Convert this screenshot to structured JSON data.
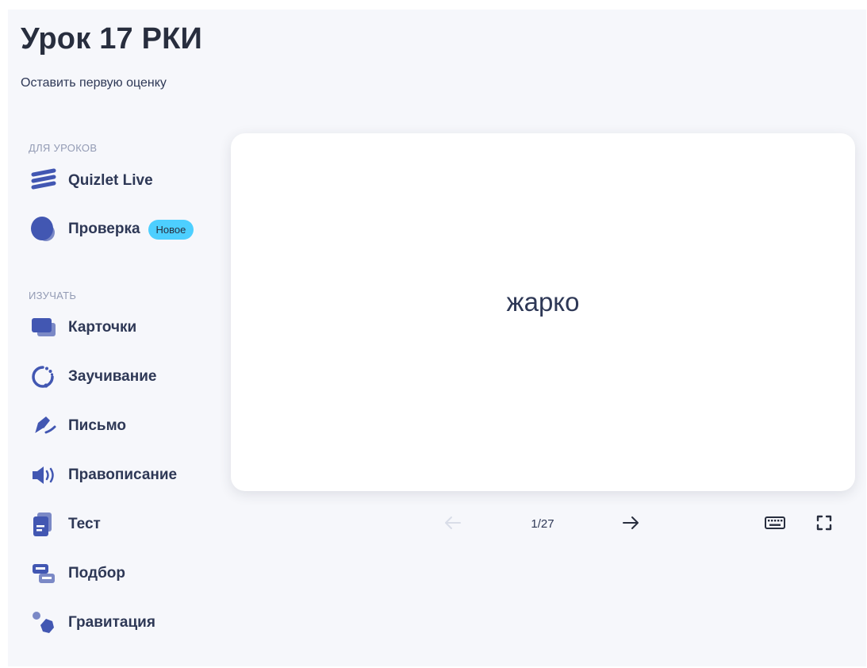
{
  "header": {
    "title": "Урок 17 РКИ",
    "rate_link": "Оставить первую оценку"
  },
  "sidebar": {
    "section_lessons": "ДЛЯ УРОКОВ",
    "lesson_items": [
      {
        "label": "Quizlet Live",
        "icon": "quizlet-live-icon"
      },
      {
        "label": "Проверка",
        "icon": "checkpoint-icon",
        "badge": "Новое"
      }
    ],
    "section_study": "ИЗУЧАТЬ",
    "study_items": [
      {
        "label": "Карточки",
        "icon": "flashcards-icon"
      },
      {
        "label": "Заучивание",
        "icon": "learn-icon"
      },
      {
        "label": "Письмо",
        "icon": "write-icon"
      },
      {
        "label": "Правописание",
        "icon": "spell-icon"
      },
      {
        "label": "Тест",
        "icon": "test-icon"
      },
      {
        "label": "Подбор",
        "icon": "match-icon"
      },
      {
        "label": "Гравитация",
        "icon": "gravity-icon"
      }
    ]
  },
  "card": {
    "term": "жарко"
  },
  "controls": {
    "counter": "1/27",
    "prev_disabled": true
  },
  "colors": {
    "accent": "#4257b2",
    "badge": "#4dcfff",
    "panel_bg": "#f6f7fb",
    "text": "#2e3856"
  }
}
